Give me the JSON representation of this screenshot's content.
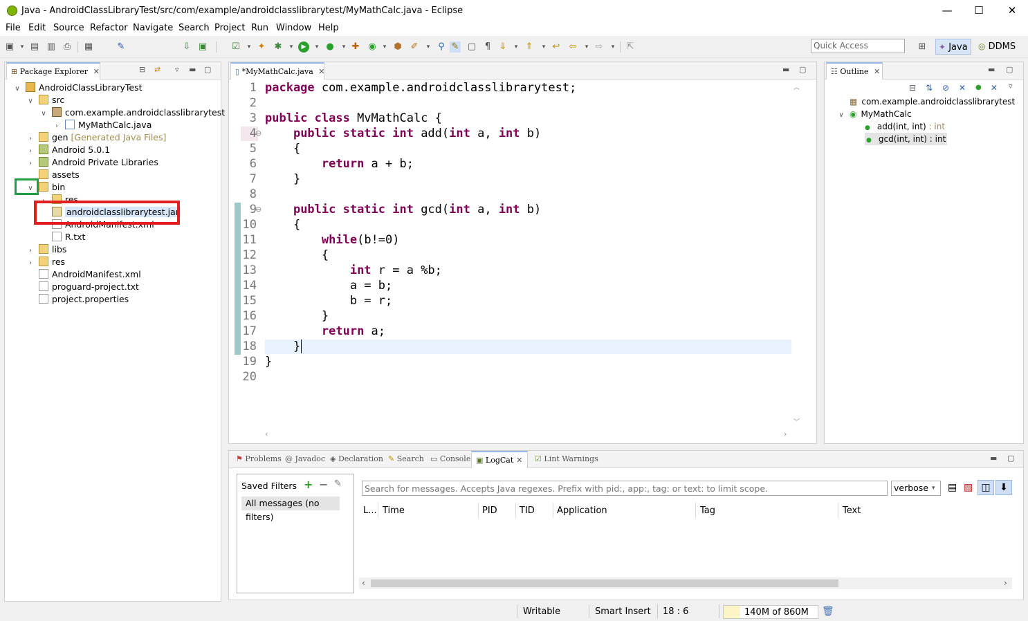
{
  "window": {
    "title": "Java - AndroidClassLibraryTest/src/com/example/androidclasslibrarytest/MyMathCalc.java - Eclipse",
    "min": "—",
    "max": "☐",
    "close": "✕"
  },
  "menu": [
    "File",
    "Edit",
    "Source",
    "Refactor",
    "Navigate",
    "Search",
    "Project",
    "Run",
    "Window",
    "Help"
  ],
  "toolbar": {
    "quick_access": "Quick Access",
    "perspectives": [
      "Java",
      "DDMS"
    ]
  },
  "package_explorer": {
    "tab": "Package Explorer",
    "tree": [
      {
        "label": "AndroidClassLibraryTest",
        "icon": "project-icon",
        "expand": "∨"
      },
      {
        "label": "src",
        "icon": "source-folder-icon",
        "expand": "∨"
      },
      {
        "label": "com.example.androidclasslibrarytest",
        "icon": "package-icon",
        "expand": "∨"
      },
      {
        "label": "MyMathCalc.java",
        "icon": "java-file-icon",
        "expand": "›"
      },
      {
        "label": "gen",
        "extra": "[Generated Java Files]",
        "icon": "folder-icon",
        "expand": "›"
      },
      {
        "label": "Android 5.0.1",
        "icon": "library-icon",
        "expand": "›"
      },
      {
        "label": "Android Private Libraries",
        "icon": "library-icon",
        "expand": "›"
      },
      {
        "label": "assets",
        "icon": "folder-icon",
        "expand": ""
      },
      {
        "label": "bin",
        "icon": "folder-icon",
        "expand": "∨"
      },
      {
        "label": "res",
        "icon": "folder-icon",
        "expand": "›"
      },
      {
        "label": "androidclasslibrarytest.jar",
        "icon": "jar-icon",
        "expand": ""
      },
      {
        "label": "AndroidManifest.xml",
        "icon": "xml-file-icon",
        "expand": ""
      },
      {
        "label": "R.txt",
        "icon": "file-icon",
        "expand": ""
      },
      {
        "label": "libs",
        "icon": "folder-icon",
        "expand": "›"
      },
      {
        "label": "res",
        "icon": "folder-icon",
        "expand": "›"
      },
      {
        "label": "AndroidManifest.xml",
        "icon": "xml-file-icon",
        "expand": ""
      },
      {
        "label": "proguard-project.txt",
        "icon": "file-icon",
        "expand": ""
      },
      {
        "label": "project.properties",
        "icon": "file-icon",
        "expand": ""
      }
    ]
  },
  "editor": {
    "tab": "*MyMathCalc.java",
    "lines": [
      [
        {
          "k": "package"
        },
        {
          "t": " com.example.androidclasslibrarytest;"
        }
      ],
      [],
      [
        {
          "k": "public class"
        },
        {
          "t": " MvMathCalc {"
        }
      ],
      [
        {
          "t": "    "
        },
        {
          "k": "public static int"
        },
        {
          "t": " add("
        },
        {
          "k": "int"
        },
        {
          "t": " a, "
        },
        {
          "k": "int"
        },
        {
          "t": " b)"
        }
      ],
      [
        {
          "t": "    {"
        }
      ],
      [
        {
          "t": "        "
        },
        {
          "k": "return"
        },
        {
          "t": " a + b;"
        }
      ],
      [
        {
          "t": "    }"
        }
      ],
      [],
      [
        {
          "t": "    "
        },
        {
          "k": "public static int"
        },
        {
          "t": " gcd("
        },
        {
          "k": "int"
        },
        {
          "t": " a, "
        },
        {
          "k": "int"
        },
        {
          "t": " b)"
        }
      ],
      [
        {
          "t": "    {"
        }
      ],
      [
        {
          "t": "        "
        },
        {
          "k": "while"
        },
        {
          "t": "(b!=0)"
        }
      ],
      [
        {
          "t": "        {"
        }
      ],
      [
        {
          "t": "            "
        },
        {
          "k": "int"
        },
        {
          "t": " r = a %b;"
        }
      ],
      [
        {
          "t": "            a = b;"
        }
      ],
      [
        {
          "t": "            b = r;"
        }
      ],
      [
        {
          "t": "        }"
        }
      ],
      [
        {
          "t": "        "
        },
        {
          "k": "return"
        },
        {
          "t": " a;"
        }
      ],
      [
        {
          "t": "    }"
        }
      ],
      [
        {
          "t": "}"
        }
      ],
      []
    ]
  },
  "outline": {
    "tab": "Outline",
    "items": [
      {
        "label": "com.example.androidclasslibrarytest",
        "icon": "package-icon"
      },
      {
        "label": "MyMathCalc",
        "icon": "class-icon"
      },
      {
        "label": "add(int, int)",
        "type": " : int",
        "icon": "static-method-icon"
      },
      {
        "label": "gcd(int, int)",
        "type": " : int",
        "icon": "static-method-icon"
      }
    ]
  },
  "bottom": {
    "tabs": [
      "Problems",
      "Javadoc",
      "Declaration",
      "Search",
      "Console",
      "LogCat",
      "Lint Warnings"
    ],
    "saved_filters": "Saved Filters",
    "all_messages": "All messages (no filters)",
    "search_placeholder": "Search for messages. Accepts Java regexes. Prefix with pid:, app:, tag: or text: to limit scope.",
    "level": "verbose",
    "columns": [
      "L...",
      "Time",
      "PID",
      "TID",
      "Application",
      "Tag",
      "Text"
    ]
  },
  "status": {
    "writable": "Writable",
    "insert": "Smart Insert",
    "position": "18 : 6",
    "memory": "140M of 860M"
  }
}
